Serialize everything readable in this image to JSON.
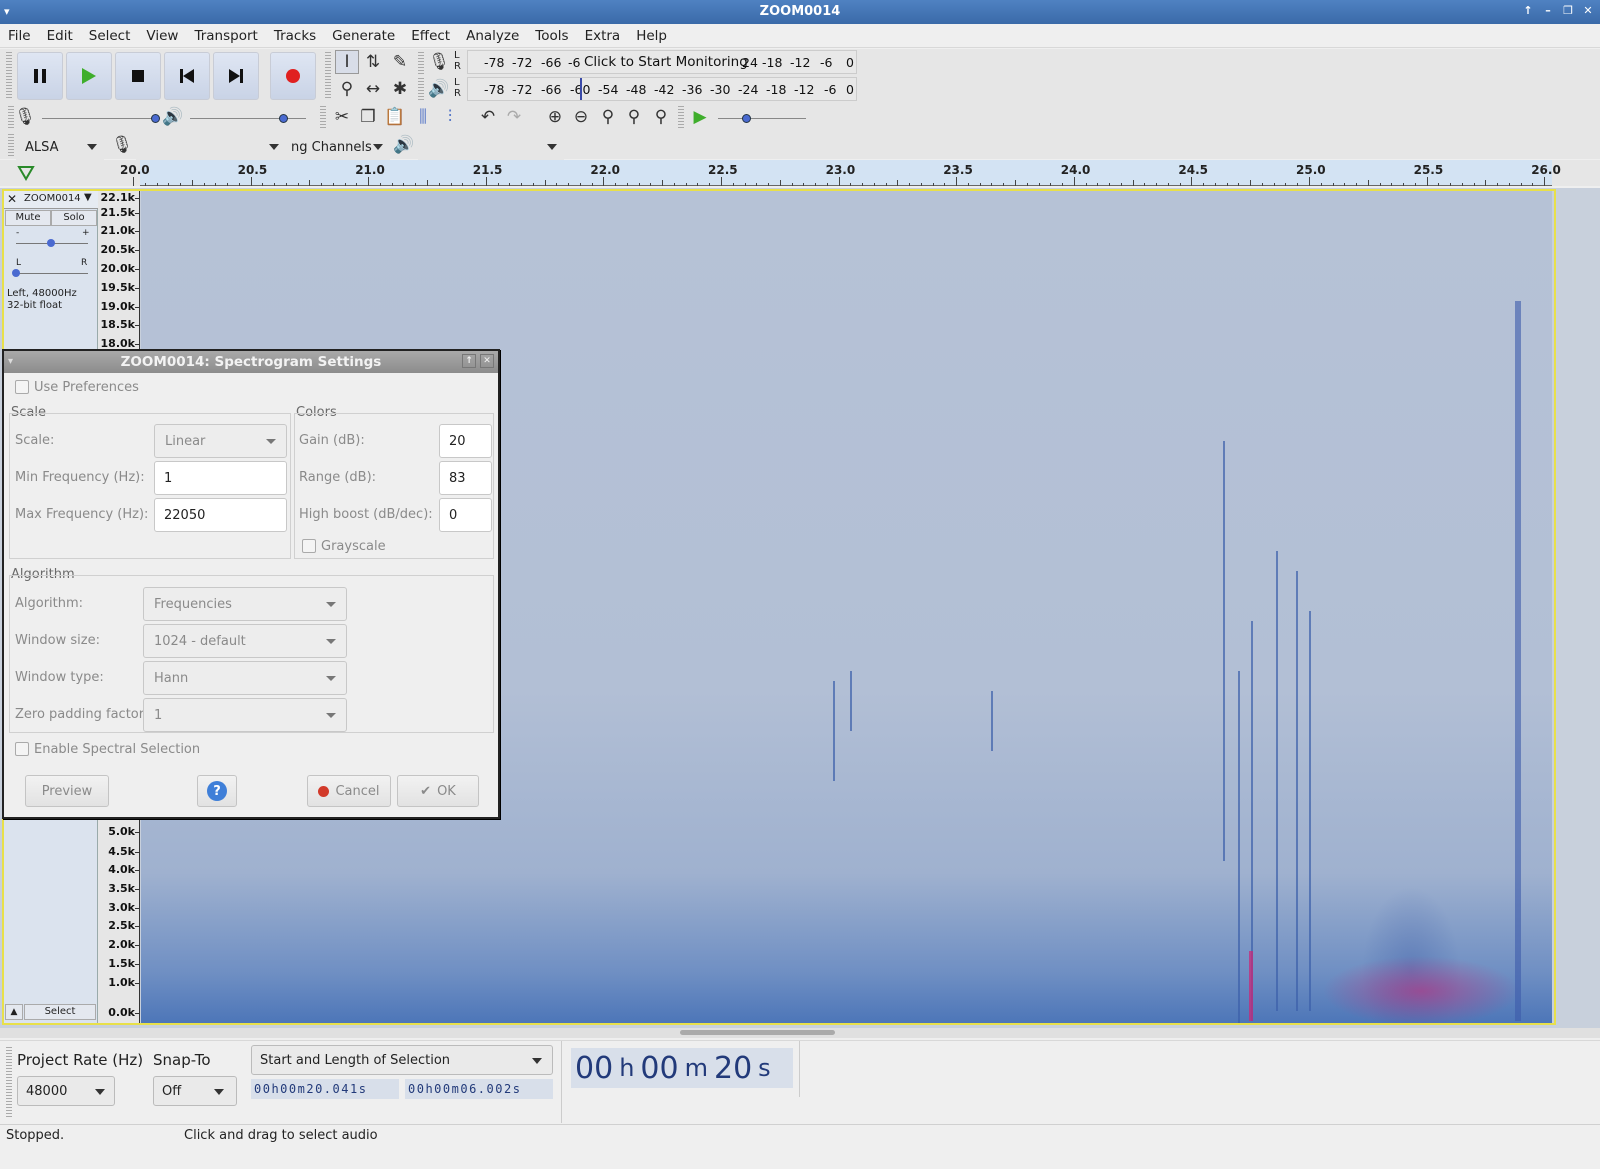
{
  "window": {
    "title": "ZOOM0014"
  },
  "menu": [
    "File",
    "Edit",
    "Select",
    "View",
    "Transport",
    "Tracks",
    "Generate",
    "Effect",
    "Analyze",
    "Tools",
    "Extra",
    "Help"
  ],
  "meters": {
    "record_scale": [
      "-78",
      "-72",
      "-66",
      "-6"
    ],
    "record_scale_right": [
      "24",
      "-18",
      "-12",
      "-6",
      "0"
    ],
    "record_prompt": "Click to Start Monitoring",
    "playback_scale": [
      "-78",
      "-72",
      "-66",
      "-60",
      "-54",
      "-48",
      "-42",
      "-36",
      "-30",
      "-24",
      "-18",
      "-12",
      "-6",
      "0"
    ],
    "L": "L",
    "R": "R"
  },
  "device": {
    "host": "ALSA",
    "channels": "ng Channels"
  },
  "ruler": {
    "labels": [
      "20.0",
      "20.5",
      "21.0",
      "21.5",
      "22.0",
      "22.5",
      "23.0",
      "23.5",
      "24.0",
      "24.5",
      "25.0",
      "25.5",
      "26.0"
    ]
  },
  "track": {
    "name": "ZOOM0014",
    "mute": "Mute",
    "solo": "Solo",
    "gain_minus": "-",
    "gain_plus": "+",
    "pan_left": "L",
    "pan_right": "R",
    "info_line1": "Left, 48000Hz",
    "info_line2": "32-bit float",
    "select": "Select"
  },
  "freq_labels_top": [
    "22.1k",
    "21.5k",
    "21.0k",
    "20.5k",
    "20.0k",
    "19.5k",
    "19.0k",
    "18.5k",
    "18.0k"
  ],
  "freq_labels_bottom": [
    "5.0k",
    "4.5k",
    "4.0k",
    "3.5k",
    "3.0k",
    "2.5k",
    "2.0k",
    "1.5k",
    "1.0k",
    "0.0k"
  ],
  "dialog": {
    "title": "ZOOM0014: Spectrogram Settings",
    "use_preferences": "Use Preferences",
    "scale_group": "Scale",
    "colors_group": "Colors",
    "scale_label": "Scale:",
    "scale_value": "Linear",
    "min_freq_label": "Min Frequency (Hz):",
    "min_freq_value": "1",
    "max_freq_label": "Max Frequency (Hz):",
    "max_freq_value": "22050",
    "gain_label": "Gain (dB):",
    "gain_value": "20",
    "range_label": "Range (dB):",
    "range_value": "83",
    "boost_label": "High boost (dB/dec):",
    "boost_value": "0",
    "grayscale": "Grayscale",
    "algorithm_group": "Algorithm",
    "algorithm_label": "Algorithm:",
    "algorithm_value": "Frequencies",
    "window_size_label": "Window size:",
    "window_size_value": "1024 - default",
    "window_type_label": "Window type:",
    "window_type_value": "Hann",
    "zero_pad_label": "Zero padding factor:",
    "zero_pad_value": "1",
    "spectral_selection": "Enable Spectral Selection",
    "preview": "Preview",
    "help": "?",
    "cancel": "Cancel",
    "ok": "OK"
  },
  "bottom": {
    "project_rate_label": "Project Rate (Hz)",
    "project_rate_value": "48000",
    "snap_label": "Snap-To",
    "snap_value": "Off",
    "selection_mode": "Start and Length of Selection",
    "start_time": "00h00m20.041s",
    "length_time": "00h00m06.002s",
    "position": {
      "h": "00",
      "hu": "h",
      "m": "00",
      "mu": "m",
      "s": "20",
      "su": "s"
    }
  },
  "status": {
    "state": "Stopped.",
    "hint": "Click and drag to select audio"
  }
}
